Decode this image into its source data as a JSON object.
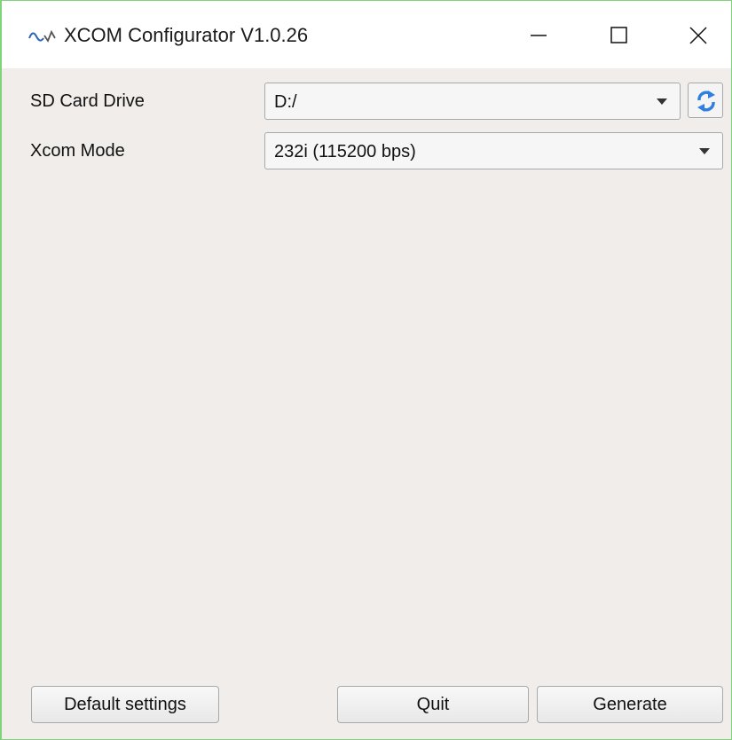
{
  "window": {
    "title": "XCOM Configurator V1.0.26"
  },
  "form": {
    "sd_card_label": "SD Card Drive",
    "sd_card_value": "D:/",
    "xcom_mode_label": "Xcom Mode",
    "xcom_mode_value": "232i (115200 bps)"
  },
  "buttons": {
    "default_settings": "Default settings",
    "quit": "Quit",
    "generate": "Generate"
  },
  "icons": {
    "app": "waveform-app-icon",
    "refresh": "refresh-icon",
    "minimize": "minimize-icon",
    "maximize": "maximize-icon",
    "close": "close-icon"
  },
  "colors": {
    "window_border": "#7fd37a",
    "refresh_blue": "#2f7fe0",
    "background": "#f0edea"
  }
}
